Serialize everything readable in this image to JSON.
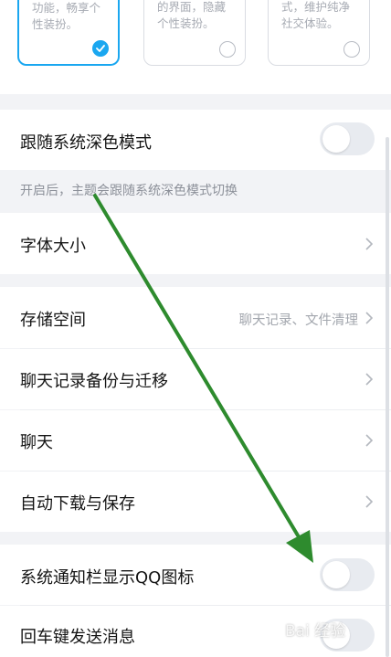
{
  "theme_cards": [
    {
      "desc": "功能，畅享个\n性装扮。",
      "selected": true
    },
    {
      "desc": "的界面，隐藏\n个性装扮。",
      "selected": false
    },
    {
      "desc": "式，维护纯净\n社交体验。",
      "selected": false
    }
  ],
  "settings": {
    "follow_dark": {
      "label": "跟随系统深色模式",
      "hint": "开启后，主题会跟随系统深色模式切换",
      "enabled": false
    },
    "font_size": {
      "label": "字体大小"
    },
    "storage": {
      "label": "存储空间",
      "subtitle": "聊天记录、文件清理"
    },
    "backup": {
      "label": "聊天记录备份与迁移"
    },
    "chat": {
      "label": "聊天"
    },
    "auto_download": {
      "label": "自动下载与保存"
    },
    "qq_icon": {
      "label": "系统通知栏显示QQ图标",
      "enabled": false
    },
    "enter_send": {
      "label": "回车键发送消息",
      "enabled": false
    }
  },
  "watermark": "Bai 经验",
  "colors": {
    "accent": "#1aa7f0",
    "arrow": "#2e8b2e"
  }
}
